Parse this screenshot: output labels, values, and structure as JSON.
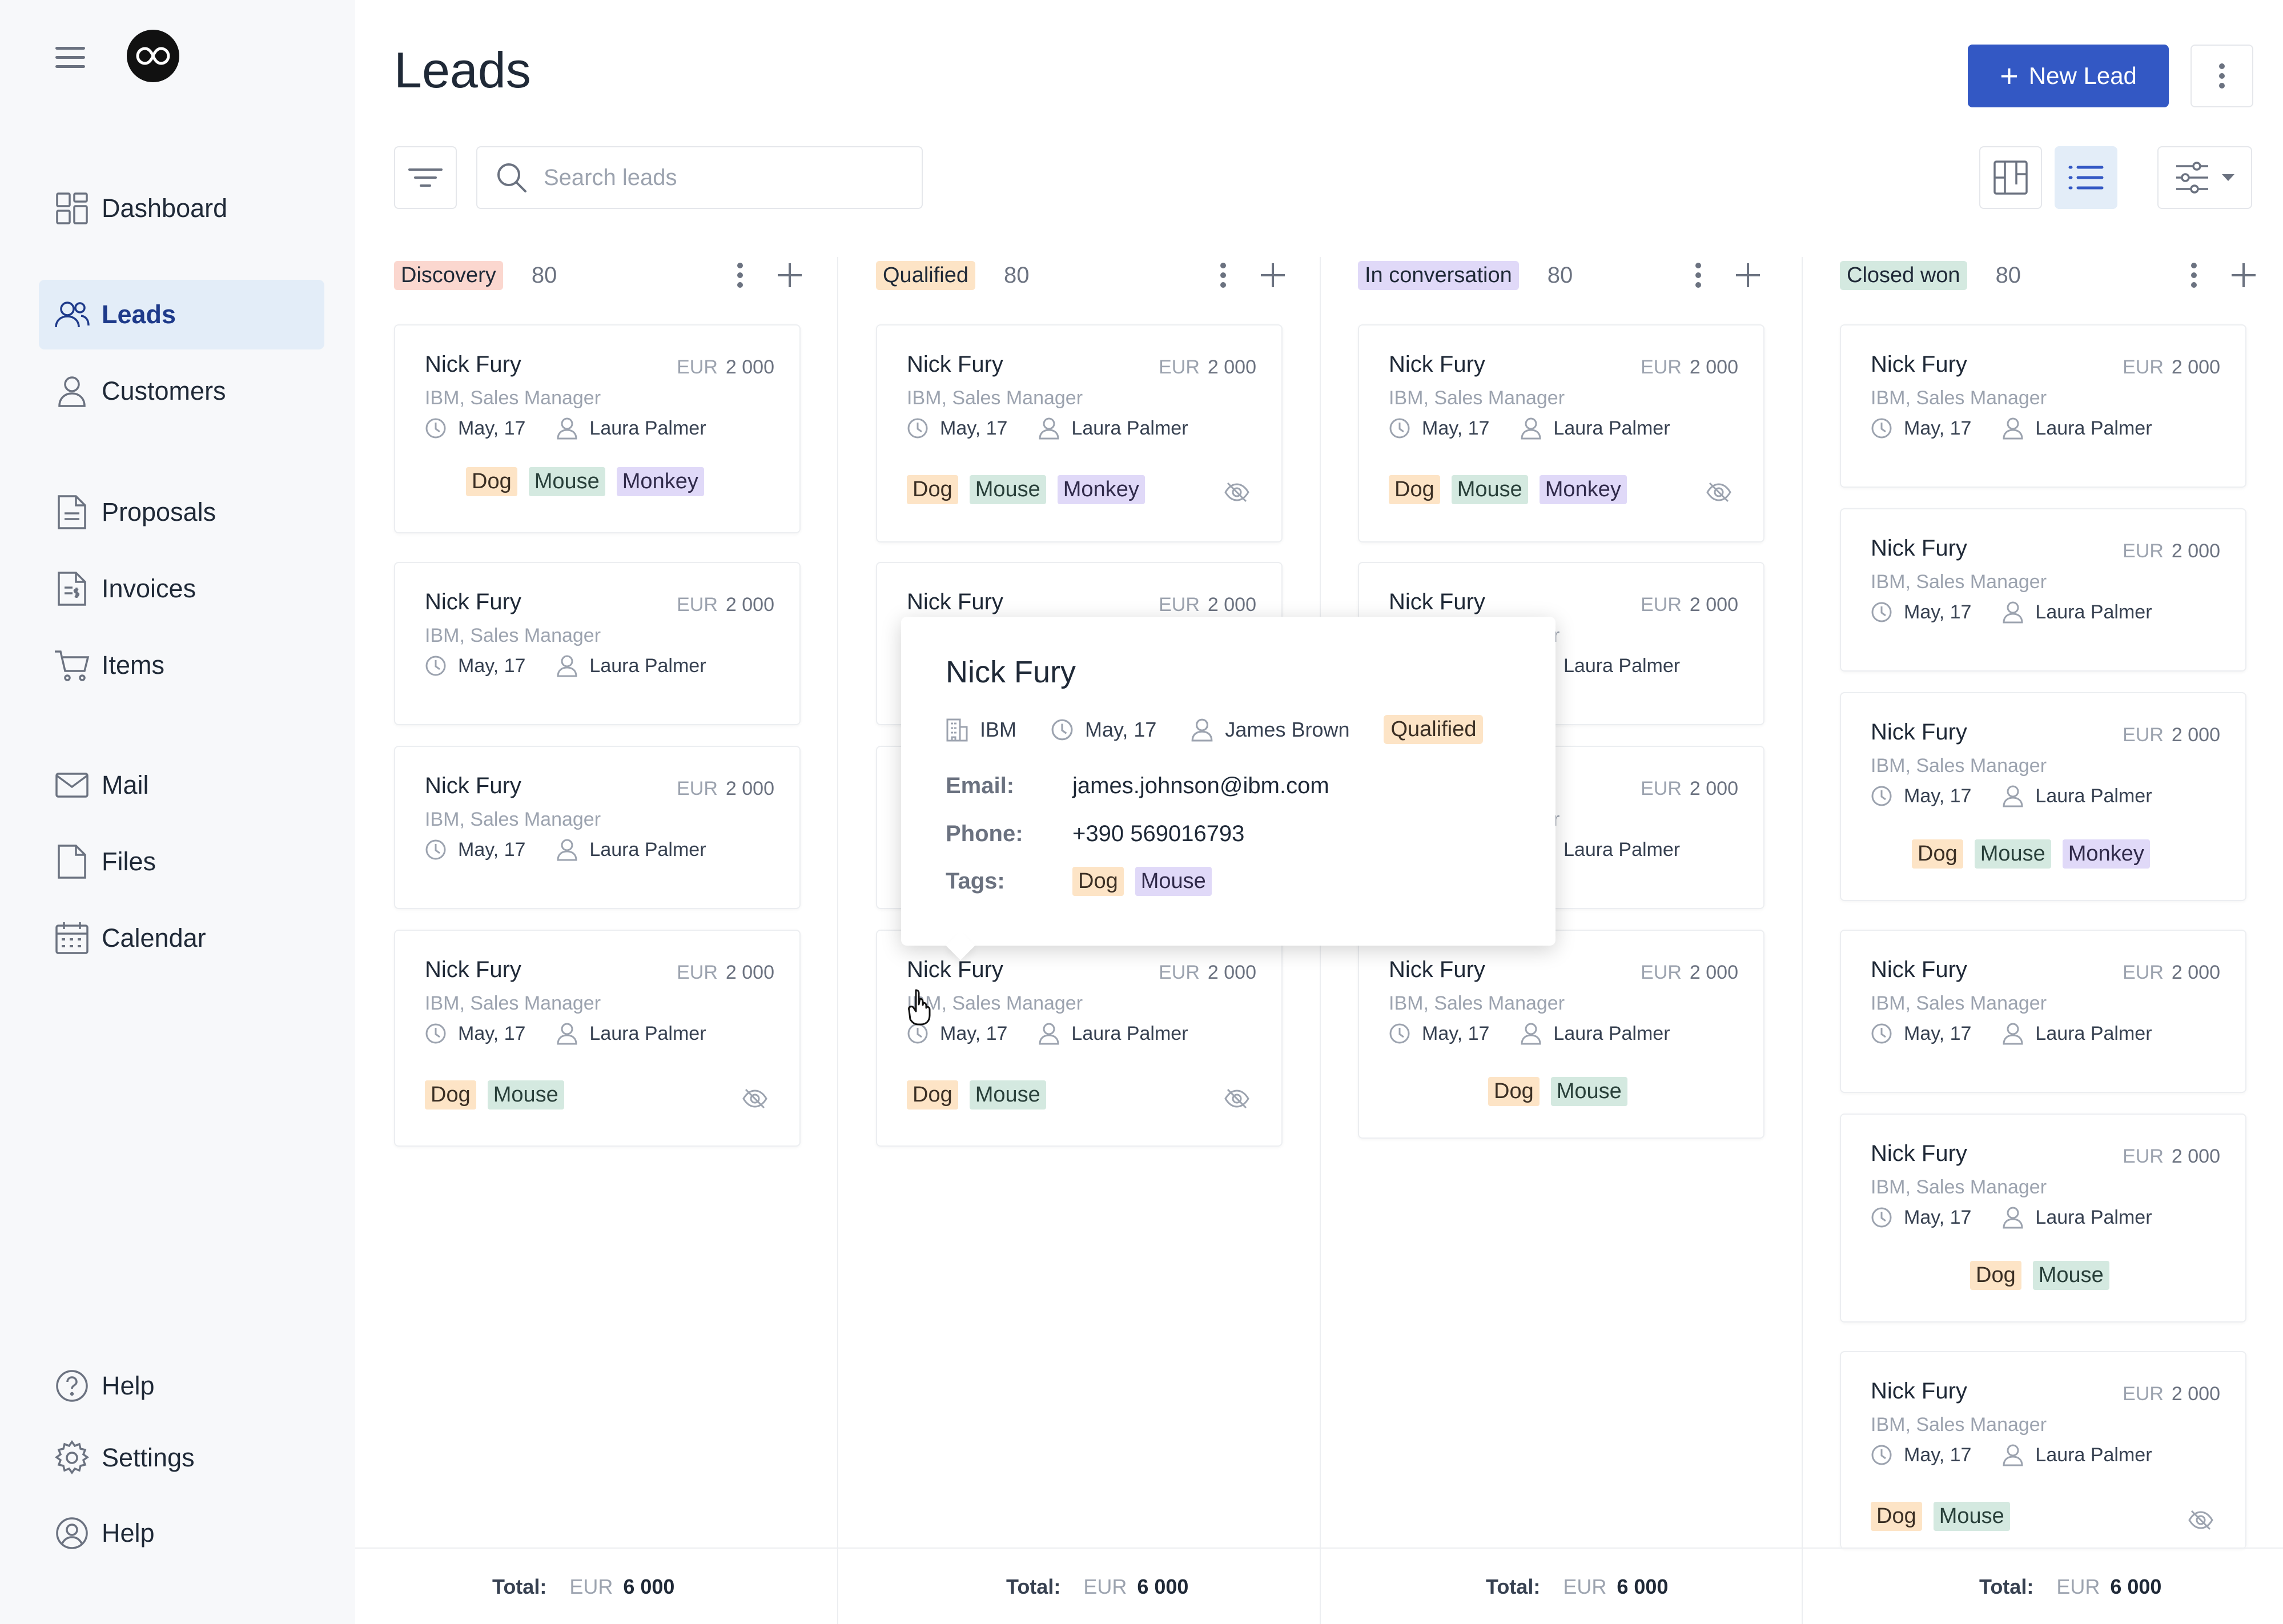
{
  "sidebar": {
    "items": [
      {
        "label": "Dashboard",
        "icon": "grid-icon"
      },
      {
        "label": "Leads",
        "icon": "users-icon",
        "active": true
      },
      {
        "label": "Customers",
        "icon": "user-icon"
      },
      {
        "label": "Proposals",
        "icon": "document-icon"
      },
      {
        "label": "Invoices",
        "icon": "invoice-icon"
      },
      {
        "label": "Items",
        "icon": "cart-icon"
      },
      {
        "label": "Mail",
        "icon": "mail-icon"
      },
      {
        "label": "Files",
        "icon": "file-icon"
      },
      {
        "label": "Calendar",
        "icon": "calendar-icon"
      }
    ],
    "bottom": [
      {
        "label": "Help",
        "icon": "help-icon"
      },
      {
        "label": "Settings",
        "icon": "gear-icon"
      },
      {
        "label": "Help",
        "icon": "profile-icon"
      }
    ]
  },
  "header": {
    "title": "Leads",
    "new_lead_label": "New Lead"
  },
  "search": {
    "placeholder": "Search leads"
  },
  "columns": [
    {
      "status": "Discovery",
      "count": "80",
      "cards": [
        {
          "name": "Nick Fury",
          "currency": "EUR",
          "amount": "2 000",
          "role": "IBM, Sales Manager",
          "date": "May, 17",
          "owner": "Laura Palmer",
          "tags": [
            "Dog",
            "Mouse",
            "Monkey"
          ]
        },
        {
          "name": "Nick Fury",
          "currency": "EUR",
          "amount": "2 000",
          "role": "IBM, Sales Manager",
          "date": "May, 17",
          "owner": "Laura Palmer"
        },
        {
          "name": "Nick Fury",
          "currency": "EUR",
          "amount": "2 000",
          "role": "IBM, Sales Manager",
          "date": "May, 17",
          "owner": "Laura Palmer"
        },
        {
          "name": "Nick Fury",
          "currency": "EUR",
          "amount": "2 000",
          "role": "IBM, Sales Manager",
          "date": "May, 17",
          "owner": "Laura Palmer",
          "tags": [
            "Dog",
            "Mouse"
          ]
        }
      ],
      "total_label": "Total:",
      "total_currency": "EUR",
      "total_value": "6 000"
    },
    {
      "status": "Qualified",
      "count": "80",
      "cards": [
        {
          "name": "Nick Fury",
          "currency": "EUR",
          "amount": "2 000",
          "role": "IBM, Sales Manager",
          "date": "May, 17",
          "owner": "Laura Palmer",
          "tags": [
            "Dog",
            "Mouse",
            "Monkey"
          ]
        },
        {
          "name": "Nick Fury",
          "currency": "EUR",
          "amount": "2 000"
        },
        {
          "name": "",
          "currency": "",
          "amount": ""
        },
        {
          "name": "Nick Fury",
          "currency": "EUR",
          "amount": "2 000",
          "role": "IBM, Sales Manager",
          "date": "May, 17",
          "owner": "Laura Palmer",
          "tags": [
            "Dog",
            "Mouse"
          ]
        }
      ],
      "total_label": "Total:",
      "total_currency": "EUR",
      "total_value": "6 000"
    },
    {
      "status": "In conversation",
      "count": "80",
      "cards": [
        {
          "name": "Nick Fury",
          "currency": "EUR",
          "amount": "2 000",
          "role": "IBM, Sales Manager",
          "date": "May, 17",
          "owner": "Laura Palmer",
          "tags": [
            "Dog",
            "Mouse",
            "Monkey"
          ]
        },
        {
          "name": "Nick Fury",
          "currency": "EUR",
          "amount": "2 000",
          "role": "r",
          "owner": "Laura Palmer"
        },
        {
          "name": "",
          "currency": "EUR",
          "amount": "2 000",
          "role": "r",
          "owner": "Laura Palmer"
        },
        {
          "name": "Nick Fury",
          "currency": "EUR",
          "amount": "2 000",
          "role": "IBM, Sales Manager",
          "date": "May, 17",
          "owner": "Laura Palmer",
          "tags": [
            "Dog",
            "Mouse"
          ]
        }
      ],
      "total_label": "Total:",
      "total_currency": "EUR",
      "total_value": "6 000"
    },
    {
      "status": "Closed won",
      "count": "80",
      "cards": [
        {
          "name": "Nick Fury",
          "currency": "EUR",
          "amount": "2 000",
          "role": "IBM, Sales Manager",
          "date": "May, 17",
          "owner": "Laura Palmer"
        },
        {
          "name": "Nick Fury",
          "currency": "EUR",
          "amount": "2 000",
          "role": "IBM, Sales Manager",
          "date": "May, 17",
          "owner": "Laura Palmer"
        },
        {
          "name": "Nick Fury",
          "currency": "EUR",
          "amount": "2 000",
          "role": "IBM, Sales Manager",
          "date": "May, 17",
          "owner": "Laura Palmer",
          "tags": [
            "Dog",
            "Mouse",
            "Monkey"
          ]
        },
        {
          "name": "Nick Fury",
          "currency": "EUR",
          "amount": "2 000",
          "role": "IBM, Sales Manager",
          "date": "May, 17",
          "owner": "Laura Palmer"
        },
        {
          "name": "Nick Fury",
          "currency": "EUR",
          "amount": "2 000",
          "role": "IBM, Sales Manager",
          "date": "May, 17",
          "owner": "Laura Palmer",
          "tags": [
            "Dog",
            "Mouse"
          ]
        },
        {
          "name": "Nick Fury",
          "currency": "EUR",
          "amount": "2 000",
          "role": "IBM, Sales Manager",
          "date": "May, 17",
          "owner": "Laura Palmer",
          "tags": [
            "Dog",
            "Mouse"
          ]
        }
      ],
      "total_label": "Total:",
      "total_currency": "EUR",
      "total_value": "6 000"
    }
  ],
  "popover": {
    "name": "Nick Fury",
    "company": "IBM",
    "date": "May, 17",
    "owner": "James Brown",
    "status": "Qualified",
    "email_label": "Email:",
    "email": "james.johnson@ibm.com",
    "phone_label": "Phone:",
    "phone": "+390 569016793",
    "tags_label": "Tags:",
    "tags": [
      "Dog",
      "Mouse"
    ]
  },
  "colors": {
    "primary": "#3358c4",
    "discovery": "#fbd7cf",
    "qualified": "#fde4c6",
    "in_conversation": "#e0d9f8",
    "closed_won": "#d4e9e0"
  }
}
